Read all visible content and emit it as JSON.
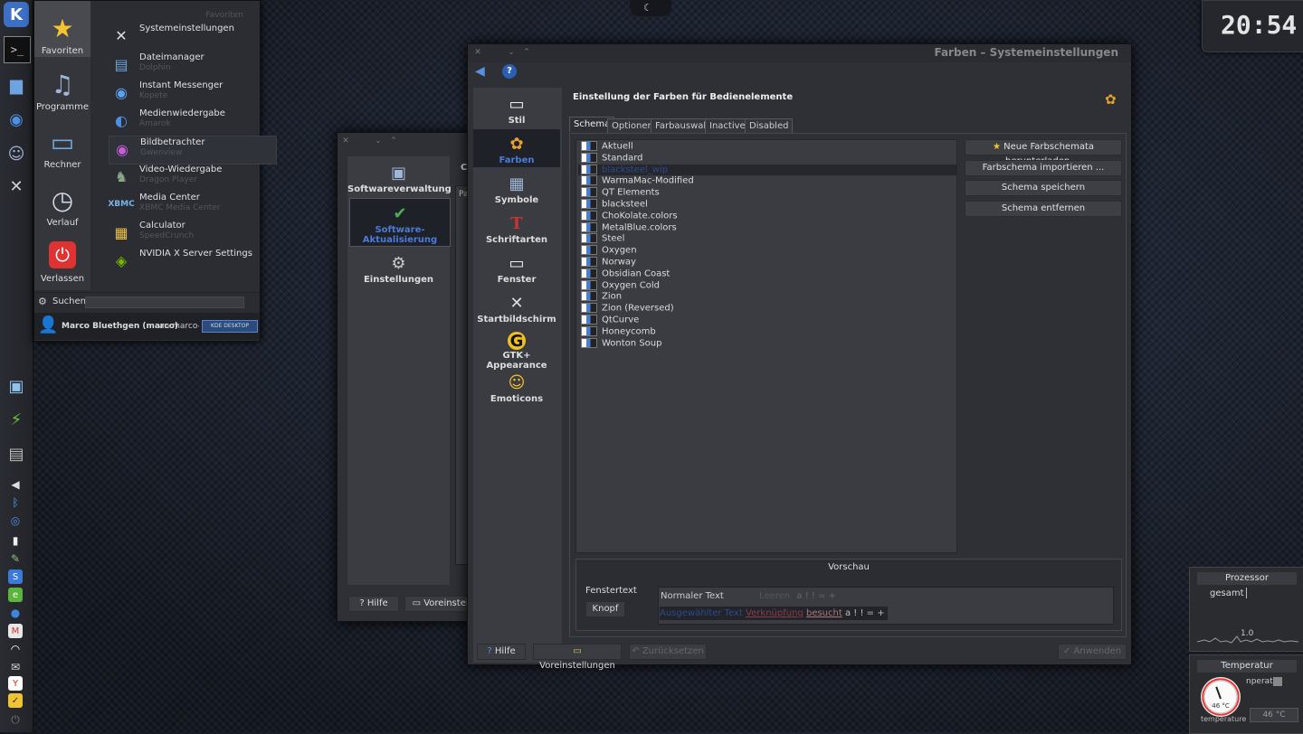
{
  "clock": {
    "time": "20:54"
  },
  "panel": {
    "top_icons": [
      "kde-menu-icon",
      "terminal-icon",
      "folder-icon",
      "chromium-icon",
      "finder-icon",
      "settings-icon"
    ],
    "bottom_icons": [
      "monitor-icon",
      "battery-icon",
      "trash-icon"
    ],
    "tray_icons": [
      "volume-icon",
      "bluetooth-icon",
      "network-icon",
      "clipboard-icon",
      "pin-icon",
      "skype-icon",
      "evernote-icon",
      "thunderbird-icon",
      "gmail-icon",
      "wifi-icon",
      "mail-icon",
      "yahoo-icon",
      "notes-icon",
      "power-icon"
    ]
  },
  "kickoff": {
    "categories": [
      {
        "label": "Favoriten",
        "icon": "star-icon"
      },
      {
        "label": "Programme",
        "icon": "programs-icon"
      },
      {
        "label": "Rechner",
        "icon": "computer-icon"
      },
      {
        "label": "Verlauf",
        "icon": "history-icon"
      },
      {
        "label": "Verlassen",
        "icon": "power-icon"
      }
    ],
    "header": "Favoriten",
    "favorites": [
      {
        "title": "Systemeinstellungen",
        "sub": ""
      },
      {
        "title": "Dateimanager",
        "sub": "Dolphin"
      },
      {
        "title": "Instant Messenger",
        "sub": "Kopete"
      },
      {
        "title": "Medienwiedergabe",
        "sub": "Amarok"
      },
      {
        "title": "Bildbetrachter",
        "sub": "Gwenview"
      },
      {
        "title": "Video-Wiedergabe",
        "sub": "Dragon Player"
      },
      {
        "title": "Media Center",
        "sub": "XBMC Media Center"
      },
      {
        "title": "Calculator",
        "sub": "SpeedCrunch"
      },
      {
        "title": "NVIDIA X Server Settings",
        "sub": ""
      }
    ],
    "search_label": "Suchen:",
    "search_value": "",
    "user": "Marco Bluethgen (marco)",
    "user_host": "an marco-",
    "badge": "KDE DESKTOP"
  },
  "bg_window": {
    "items": [
      {
        "label": "Softwareverwaltung"
      },
      {
        "label": "Software-Aktualisierung"
      },
      {
        "label": "Einstellungen"
      }
    ],
    "heading": "Ch",
    "sub": "Pac",
    "help": "Hilfe",
    "defaults": "Voreinstell"
  },
  "main_window": {
    "title": "Farben – Systemeinstellungen",
    "page_title": "Einstellung der Farben für Bedienelemente",
    "sidebar": [
      {
        "label": "Stil",
        "icon": "style-icon"
      },
      {
        "label": "Farben",
        "icon": "colors-icon"
      },
      {
        "label": "Symbole",
        "icon": "symbols-icon"
      },
      {
        "label": "Schriftarten",
        "icon": "fonts-icon"
      },
      {
        "label": "Fenster",
        "icon": "window-icon"
      },
      {
        "label": "Startbildschirm",
        "icon": "splash-icon"
      },
      {
        "label": "GTK+ Appearance",
        "icon": "gtk-icon"
      },
      {
        "label": "Emoticons",
        "icon": "emoticons-icon"
      }
    ],
    "tabs": [
      "Schema",
      "Optionen",
      "Farbauswahl",
      "Inactive",
      "Disabled"
    ],
    "schemes": [
      "Aktuell",
      "Standard",
      "blacksteel_wip",
      "WarmaMac-Modified",
      "QT Elements",
      "blacksteel",
      "ChoKolate.colors",
      "MetalBlue.colors",
      "Steel",
      "Oxygen",
      "Norway",
      "Obsidian Coast",
      "Oxygen Cold",
      "Zion",
      "Zion (Reversed)",
      "QtCurve",
      "Honeycomb",
      "Wonton Soup"
    ],
    "selected_scheme": "blacksteel_wip",
    "buttons": {
      "download": "Neue Farbschemata herunterladen ...",
      "import": "Farbschema importieren ...",
      "save": "Schema speichern",
      "remove": "Schema entfernen"
    },
    "preview": {
      "title": "Vorschau",
      "window_text": "Fenstertext",
      "button": "Knopf",
      "normal_text": "Normaler Text",
      "link": "Leeren",
      "selected_text": "Ausgewählter Text",
      "link2": "Verknüpfung",
      "visited": "besucht",
      "chars": "a ! ! = +"
    },
    "footer": {
      "help": "Hilfe",
      "defaults": "Voreinstellungen",
      "reset": "Zurücksetzen",
      "apply": "Anwenden"
    }
  },
  "widgets": {
    "cpu_title": "Prozessor",
    "cpu_label": "gesamt",
    "cpu_value": "1.0",
    "temp_title": "Temperatur",
    "temp_label": "nperatu",
    "temp_value": "46 °C",
    "temp_gauge": "46 °C",
    "temp_caption": "temperature"
  }
}
